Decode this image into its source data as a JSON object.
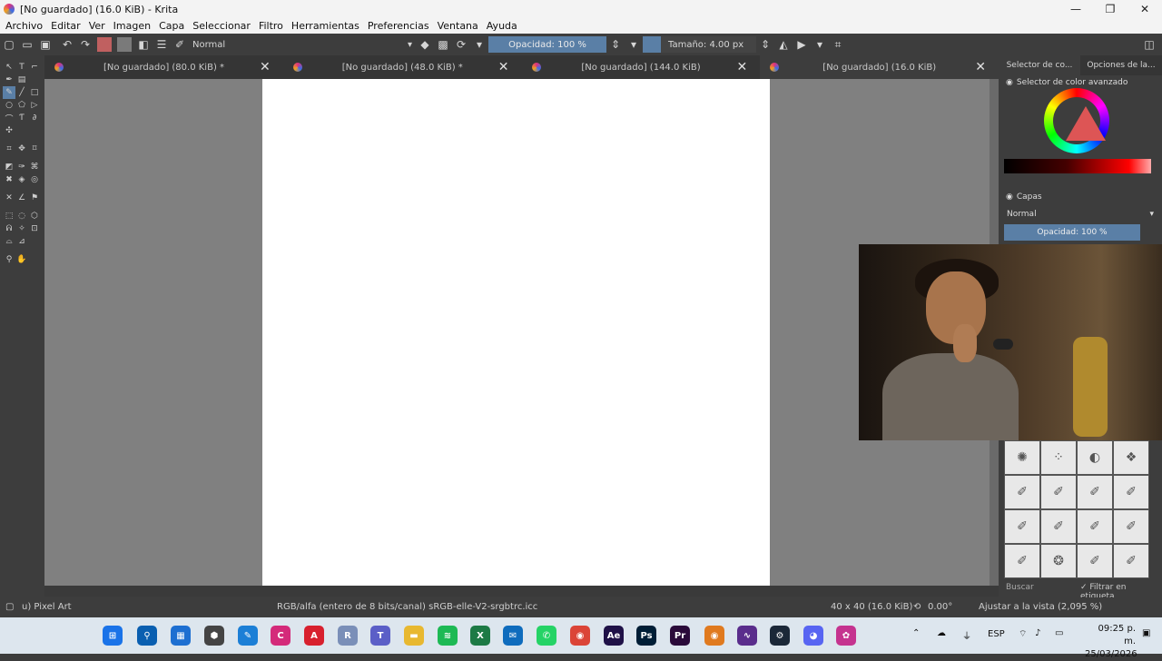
{
  "window": {
    "title": "[No guardado]  (16.0 KiB)  - Krita",
    "controls": [
      "—",
      "❐",
      "✕"
    ]
  },
  "menu": [
    "Archivo",
    "Editar",
    "Ver",
    "Imagen",
    "Capa",
    "Seleccionar",
    "Filtro",
    "Herramientas",
    "Preferencias",
    "Ventana",
    "Ayuda"
  ],
  "toolbar": {
    "blend_mode": "Normal",
    "opacity": "Opacidad: 100 %",
    "size": "Tamaño: 4.00 px",
    "colors": {
      "foreground": "#c06060",
      "background": "#7a7a7a",
      "accent": "#5a7fa6"
    }
  },
  "tabs": [
    {
      "label": "[No guardado]  (80.0 KiB) *"
    },
    {
      "label": "[No guardado]  (48.0 KiB) *"
    },
    {
      "label": "[No guardado]  (144.0 KiB)"
    },
    {
      "label": "[No guardado]  (16.0 KiB)"
    }
  ],
  "dock": {
    "tabs": [
      "Selector de co...",
      "Opciones de la..."
    ],
    "color_panel_title": "Selector de color avanzado",
    "layers_title": "Capas",
    "layer_blend": "Normal",
    "layer_opacity": "Opacidad: 100 %",
    "brush_search": "Buscar",
    "brush_filter": "✓ Filtrar en etiqueta"
  },
  "status": {
    "brush_name": "u) Pixel Art",
    "color_space": "RGB/alfa (entero de 8 bits/canal)  sRGB-elle-V2-srgbtrc.icc",
    "image_size": "40 x 40 (16.0 KiB)",
    "rotation": "0.00°",
    "zoom": "Ajustar a la vista (2,095 %)"
  },
  "taskbar": {
    "apps": [
      {
        "name": "windows-start-icon",
        "glyph": "⊞",
        "color": "#1a73e8"
      },
      {
        "name": "search-icon",
        "glyph": "⚲",
        "color": "#0a5fb0"
      },
      {
        "name": "store-icon",
        "glyph": "▦",
        "color": "#1d6fd1"
      },
      {
        "name": "app-icon",
        "glyph": "⬢",
        "color": "#444444"
      },
      {
        "name": "clip-studio-icon",
        "glyph": "✎",
        "color": "#1c7fd6"
      },
      {
        "name": "clip-studio-ex-icon",
        "glyph": "C",
        "color": "#d42a7a"
      },
      {
        "name": "acrobat-icon",
        "glyph": "A",
        "color": "#d8202e"
      },
      {
        "name": "r-app-icon",
        "glyph": "R",
        "color": "#7a8fb8"
      },
      {
        "name": "teams-icon",
        "glyph": "T",
        "color": "#5b5fc7"
      },
      {
        "name": "file-explorer-icon",
        "glyph": "▬",
        "color": "#e8b830"
      },
      {
        "name": "spotify-icon",
        "glyph": "≋",
        "color": "#1db954"
      },
      {
        "name": "excel-icon",
        "glyph": "X",
        "color": "#1d7a45"
      },
      {
        "name": "outlook-icon",
        "glyph": "✉",
        "color": "#0f6cbd"
      },
      {
        "name": "whatsapp-icon",
        "glyph": "✆",
        "color": "#25d366"
      },
      {
        "name": "chrome-icon",
        "glyph": "◉",
        "color": "#db4437"
      },
      {
        "name": "after-effects-icon",
        "glyph": "Ae",
        "color": "#1f1147"
      },
      {
        "name": "photoshop-icon",
        "glyph": "Ps",
        "color": "#001e36"
      },
      {
        "name": "premiere-icon",
        "glyph": "Pr",
        "color": "#2a0a3a"
      },
      {
        "name": "chrome-profile-icon",
        "glyph": "◉",
        "color": "#e07a1f"
      },
      {
        "name": "wave-app-icon",
        "glyph": "∿",
        "color": "#5a2d8c"
      },
      {
        "name": "steam-icon",
        "glyph": "⚙",
        "color": "#1b2838"
      },
      {
        "name": "discord-icon",
        "glyph": "◕",
        "color": "#5865f2"
      },
      {
        "name": "krita-icon",
        "glyph": "✿",
        "color": "#c5338f"
      }
    ],
    "tray": {
      "language": "ESP",
      "time": "09:25 p. m.",
      "date": "25/03/2026"
    }
  }
}
